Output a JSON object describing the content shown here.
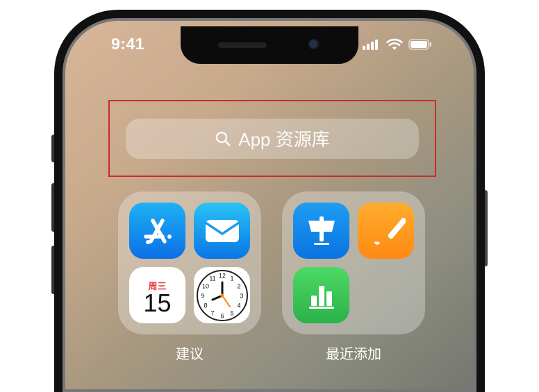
{
  "status": {
    "time": "9:41"
  },
  "search": {
    "placeholder": "App 资源库"
  },
  "calendar": {
    "dayLabel": "周三",
    "date": "15"
  },
  "folders": {
    "suggestions": {
      "label": "建议"
    },
    "recent": {
      "label": "最近添加"
    }
  }
}
